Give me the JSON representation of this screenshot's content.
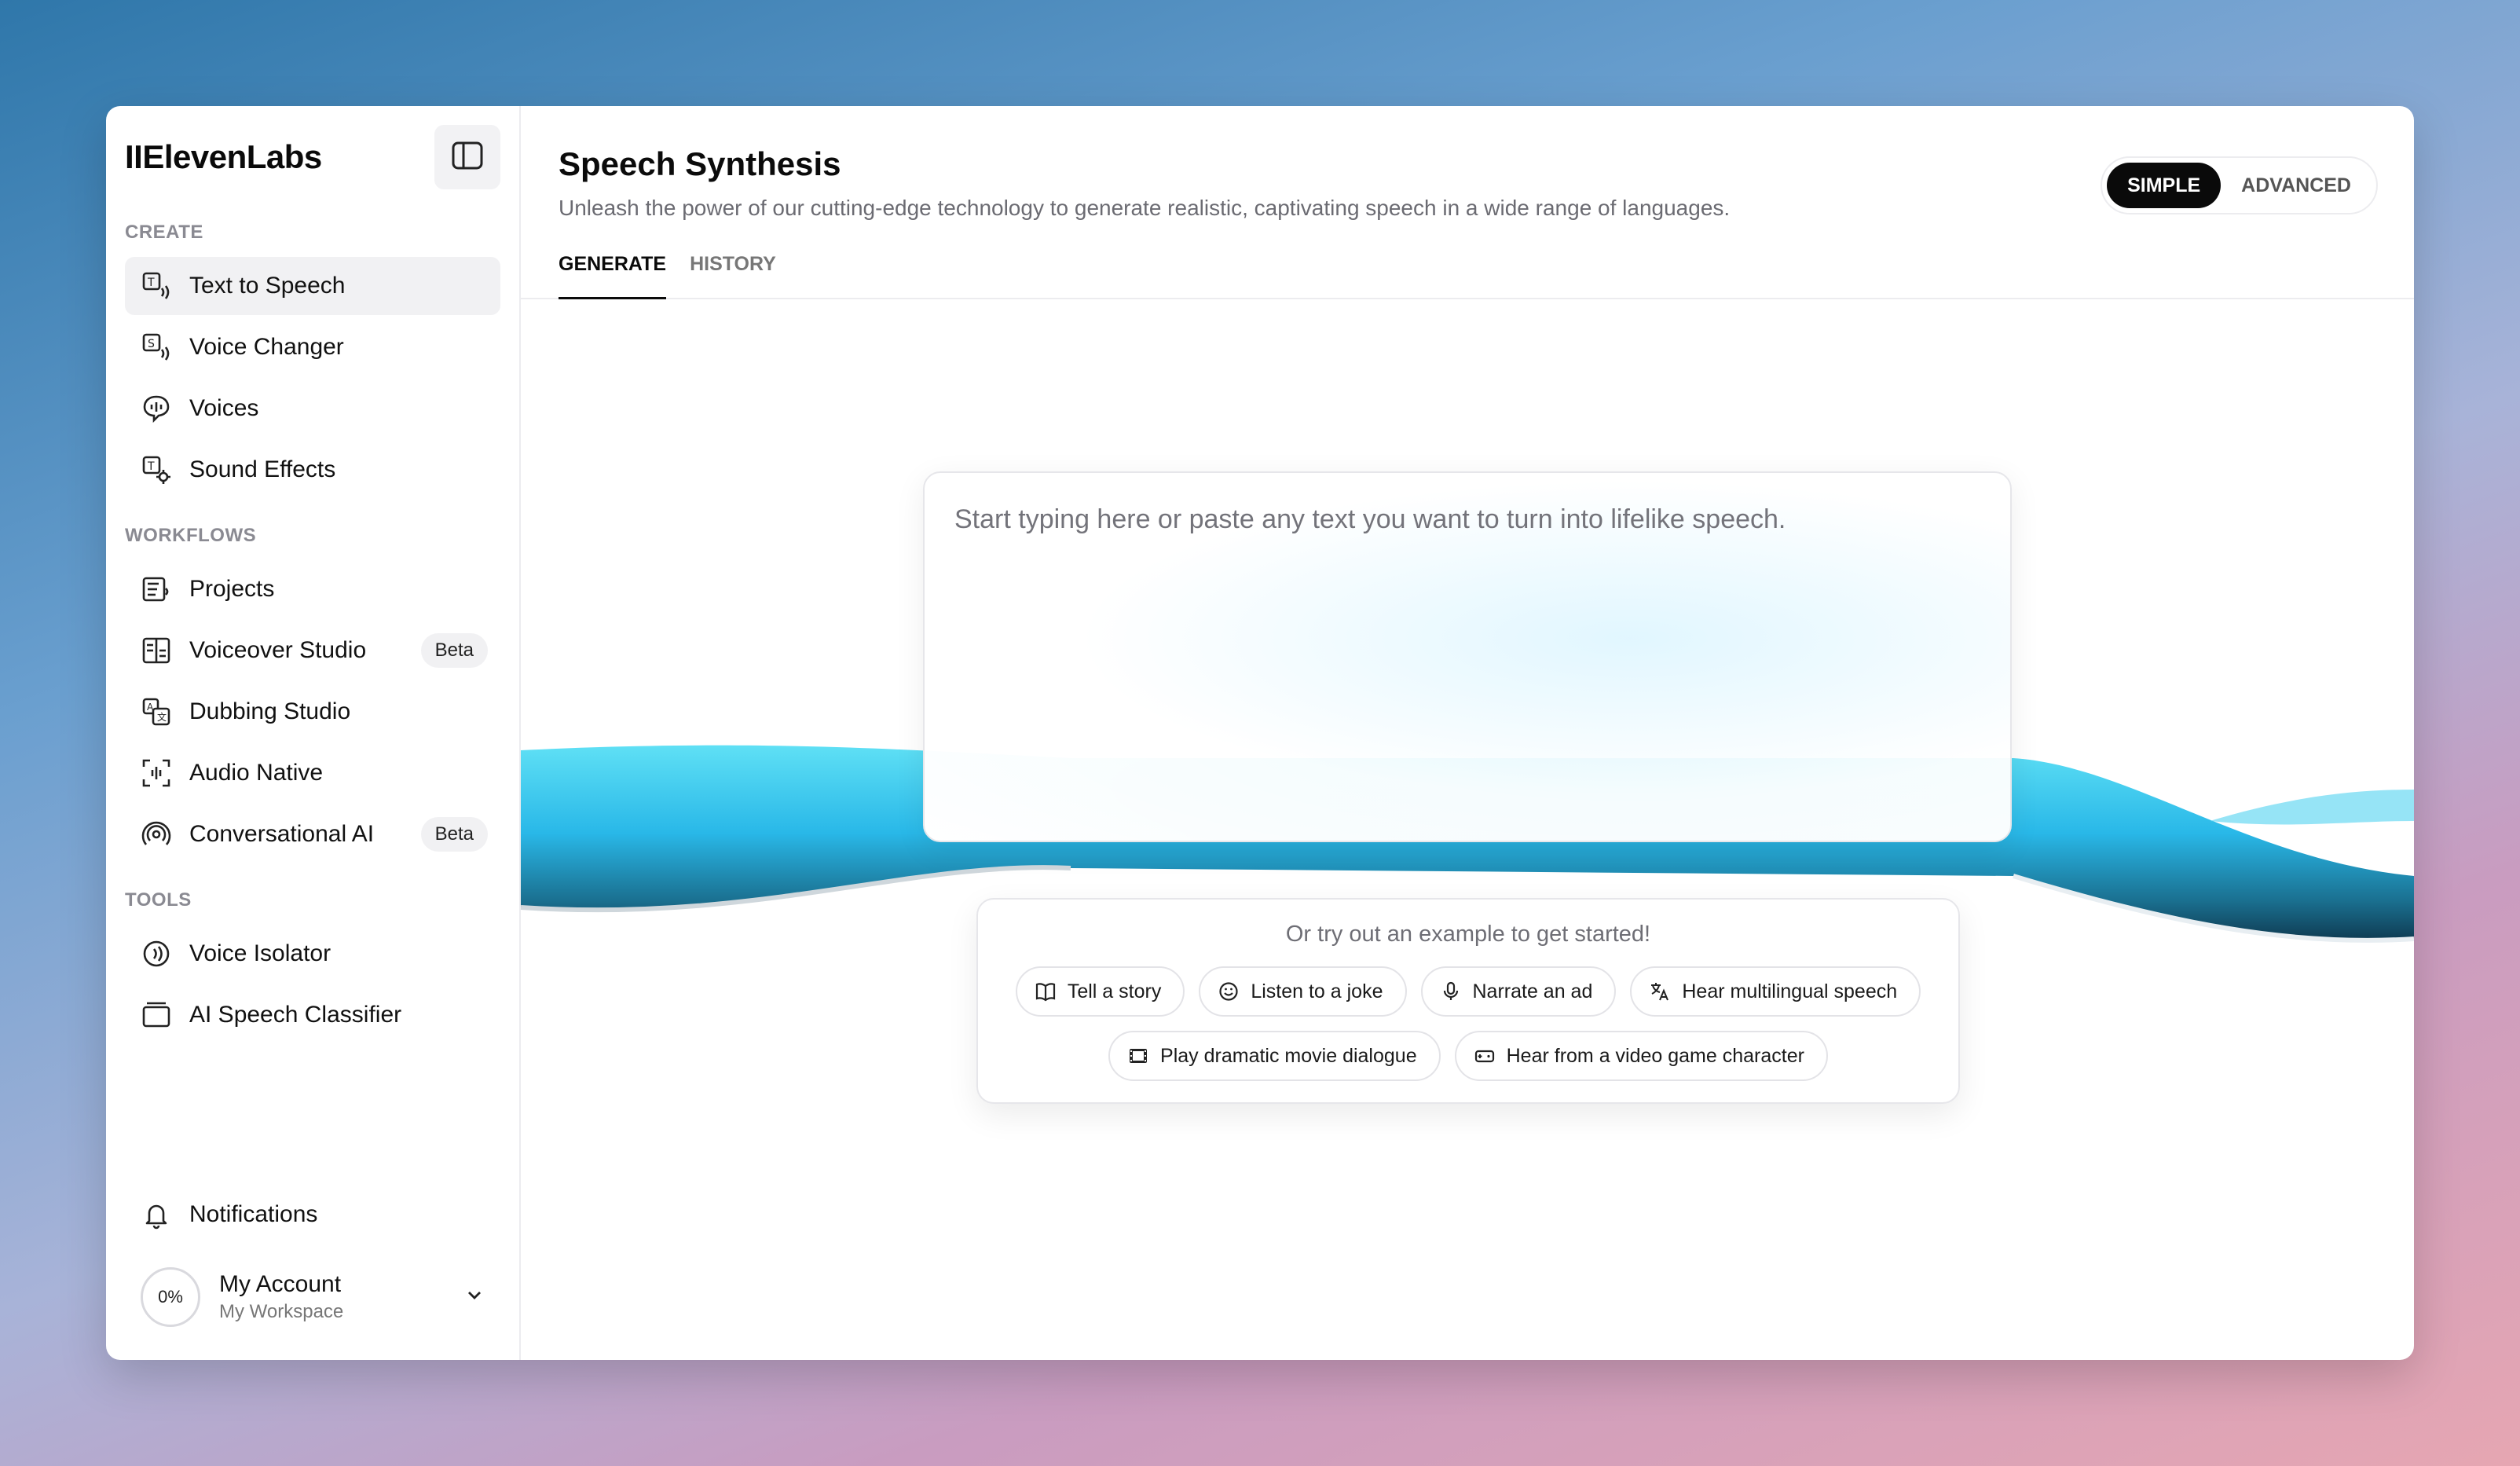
{
  "app": {
    "logo": "IIElevenLabs"
  },
  "sidebar": {
    "sections": [
      {
        "title": "CREATE",
        "items": [
          {
            "label": "Text to Speech",
            "icon": "text-to-speech-icon",
            "active": true
          },
          {
            "label": "Voice Changer",
            "icon": "voice-changer-icon"
          },
          {
            "label": "Voices",
            "icon": "voices-icon"
          },
          {
            "label": "Sound Effects",
            "icon": "sound-effects-icon"
          }
        ]
      },
      {
        "title": "WORKFLOWS",
        "items": [
          {
            "label": "Projects",
            "icon": "projects-icon"
          },
          {
            "label": "Voiceover Studio",
            "icon": "voiceover-studio-icon",
            "badge": "Beta"
          },
          {
            "label": "Dubbing Studio",
            "icon": "dubbing-studio-icon"
          },
          {
            "label": "Audio Native",
            "icon": "audio-native-icon"
          },
          {
            "label": "Conversational AI",
            "icon": "conversational-ai-icon",
            "badge": "Beta"
          }
        ]
      },
      {
        "title": "TOOLS",
        "items": [
          {
            "label": "Voice Isolator",
            "icon": "voice-isolator-icon"
          },
          {
            "label": "AI Speech Classifier",
            "icon": "ai-speech-classifier-icon"
          }
        ]
      }
    ],
    "notifications": "Notifications",
    "account": {
      "usage": "0%",
      "name": "My Account",
      "workspace": "My Workspace"
    }
  },
  "main": {
    "title": "Speech Synthesis",
    "subtitle": "Unleash the power of our cutting-edge technology to generate realistic, captivating speech in a wide range of languages.",
    "mode": {
      "simple": "SIMPLE",
      "advanced": "ADVANCED",
      "selected": "SIMPLE"
    },
    "tabs": [
      {
        "label": "GENERATE",
        "active": true
      },
      {
        "label": "HISTORY"
      }
    ],
    "editor": {
      "placeholder": "Start typing here or paste any text you want to turn into lifelike speech.",
      "value": ""
    },
    "examples": {
      "heading": "Or try out an example to get started!",
      "row1": [
        {
          "label": "Tell a story",
          "icon": "book-icon"
        },
        {
          "label": "Listen to a joke",
          "icon": "smiley-icon"
        },
        {
          "label": "Narrate an ad",
          "icon": "microphone-icon"
        },
        {
          "label": "Hear multilingual speech",
          "icon": "translate-icon"
        }
      ],
      "row2": [
        {
          "label": "Play dramatic movie dialogue",
          "icon": "film-icon"
        },
        {
          "label": "Hear from a video game character",
          "icon": "gamepad-icon"
        }
      ]
    }
  },
  "colors": {
    "accent": "#0a0a0a",
    "wave": "#33c3ef",
    "wave_dark": "#1d5f7a"
  }
}
